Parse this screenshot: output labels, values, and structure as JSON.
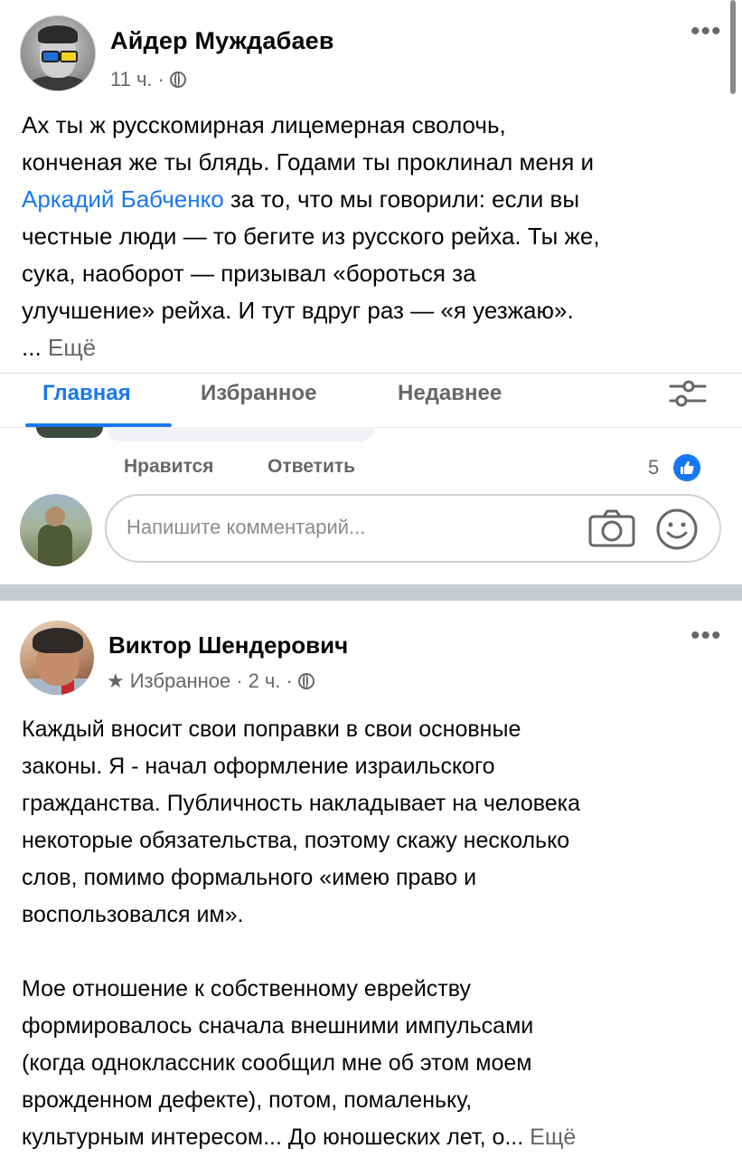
{
  "post1": {
    "author": "Айдер Муждабаев",
    "time": "11 ч.",
    "separator": "·",
    "more": "•••",
    "lines": [
      "Ах ты ж русскомирная лицемерная сволочь,",
      "конченая же ты блядь. Годами ты проклинал меня и"
    ],
    "mention": "Аркадий Бабченко",
    "mention_rest": " за то, что мы говорили: если вы",
    "lines_after": [
      "честные люди — то бегите из русского рейха. Ты же,",
      "сука, наоборот — призывал «бороться за",
      "улучшение» рейха. И тут вдруг раз — «я уезжаю»."
    ],
    "ellipsis": "... ",
    "see_more": "Ещё"
  },
  "tabs": {
    "items": [
      {
        "label": "Главная",
        "active": true
      },
      {
        "label": "Избранное",
        "active": false
      },
      {
        "label": "Недавнее",
        "active": false
      }
    ],
    "filter_icon": "filter-sliders-icon"
  },
  "comment": {
    "like_label": "Нравится",
    "reply_label": "Ответить",
    "like_count": "5",
    "input_placeholder": "Напишите комментарий...",
    "camera_icon": "camera-icon",
    "emoji_icon": "smile-icon"
  },
  "post2": {
    "author": "Виктор Шендерович",
    "badge": "Избранное",
    "time": "2 ч.",
    "separator": "·",
    "more": "•••",
    "para1": [
      "Каждый вносит свои поправки в свои основные",
      "законы.  Я - начал оформление израильского",
      "гражданства.  Публичность накладывает на человека",
      "некоторые обязательства, поэтому скажу несколько",
      "слов, помимо формального «имею право и",
      "воспользовался им»."
    ],
    "para2": [
      "Мое отношение к собственному еврейству",
      "формировалось сначала внешними импульсами",
      "(когда одноклассник сообщил мне об этом моем",
      "врожденном дефекте), потом, помаленьку,"
    ],
    "last_line": "культурным интересом...  До юношеских лет, о... ",
    "see_more": "Ещё"
  },
  "colors": {
    "accent": "#1877f2",
    "secondary_text": "#65676b",
    "separator": "#c9ccd1"
  }
}
